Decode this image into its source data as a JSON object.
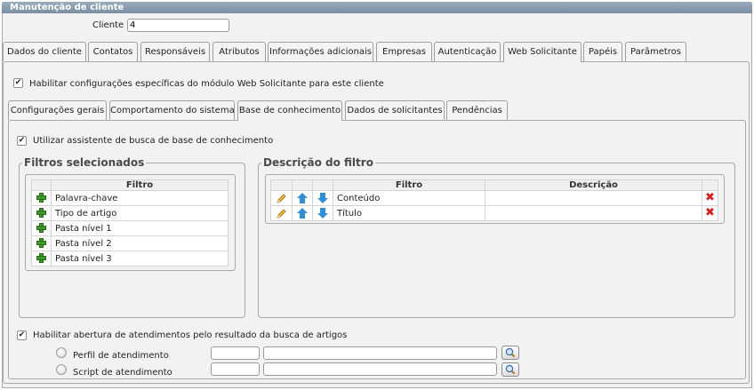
{
  "window": {
    "title": "Manutenção de cliente"
  },
  "cliente": {
    "label": "Cliente :",
    "value": "4"
  },
  "main_tabs": [
    {
      "label": "Dados do cliente"
    },
    {
      "label": "Contatos"
    },
    {
      "label": "Responsáveis"
    },
    {
      "label": "Atributos"
    },
    {
      "label": "Informações adicionais"
    },
    {
      "label": "Empresas"
    },
    {
      "label": "Autenticação"
    },
    {
      "label": "Web Solicitante"
    },
    {
      "label": "Papéis"
    },
    {
      "label": "Parâmetros"
    }
  ],
  "web_solicitante": {
    "enable_label": "Habilitar configurações específicas do módulo Web Solicitante para este cliente",
    "enable_checked": true
  },
  "sub_tabs": [
    {
      "label": "Configurações gerais"
    },
    {
      "label": "Comportamento do sistema"
    },
    {
      "label": "Base de conhecimento"
    },
    {
      "label": "Dados de solicitantes"
    },
    {
      "label": "Pendências"
    }
  ],
  "kb": {
    "assistant_label": "Utilizar assistente de busca de base de conhecimento",
    "assistant_checked": true,
    "filtros_title": "Filtros selecionados",
    "filtros_header": "Filtro",
    "filtros": [
      "Palavra-chave",
      "Tipo de artigo",
      "Pasta nível 1",
      "Pasta nível 2",
      "Pasta nível 3"
    ],
    "descricao_title": "Descrição do filtro",
    "descricao_headers": {
      "filtro": "Filtro",
      "descricao": "Descrição"
    },
    "descricao_rows": [
      {
        "filtro": "Conteúdo",
        "descricao": ""
      },
      {
        "filtro": "Título",
        "descricao": ""
      }
    ],
    "abertura_label": "Habilitar abertura de atendimentos pelo resultado da busca de artigos",
    "abertura_checked": true,
    "perfil_label": "Perfil de atendimento",
    "script_label": "Script de atendimento"
  },
  "colors": {
    "title_bar": "#8a9db1",
    "panel": "#f2f2f2",
    "plus_icon": "#3d9a2b",
    "arrow_icon": "#2f8ed6",
    "delete_icon": "#d42020"
  },
  "icons": {
    "add": "plus-icon",
    "edit": "pencil-icon",
    "up": "arrow-up-icon",
    "down": "arrow-down-icon",
    "delete": "delete-icon",
    "search": "magnifier-icon"
  }
}
